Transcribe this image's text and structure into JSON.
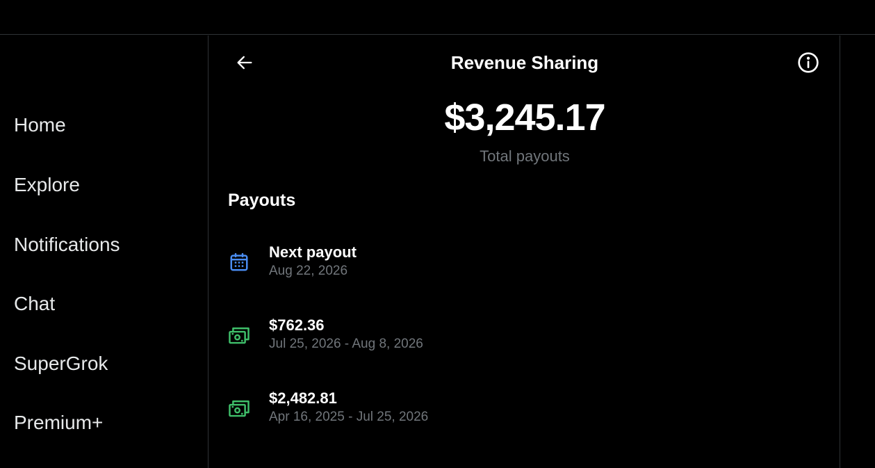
{
  "sidebar": {
    "items": [
      {
        "label": "Home"
      },
      {
        "label": "Explore"
      },
      {
        "label": "Notifications"
      },
      {
        "label": "Chat"
      },
      {
        "label": "SuperGrok"
      },
      {
        "label": "Premium+"
      }
    ]
  },
  "header": {
    "title": "Revenue Sharing",
    "back_icon": "arrow-left-icon",
    "info_icon": "info-icon"
  },
  "summary": {
    "total": "$3,245.17",
    "total_label": "Total payouts"
  },
  "payouts": {
    "section_title": "Payouts",
    "next": {
      "label": "Next payout",
      "date": "Aug 22, 2026",
      "icon": "calendar-icon"
    },
    "items": [
      {
        "amount": "$762.36",
        "period": "Jul 25, 2026 - Aug 8, 2026",
        "icon": "money-icon"
      },
      {
        "amount": "$2,482.81",
        "period": "Apr 16, 2025 - Jul 25, 2026",
        "icon": "money-icon"
      }
    ]
  },
  "colors": {
    "background": "#000000",
    "divider": "#2f3336",
    "text_primary": "#ffffff",
    "text_secondary": "#71767b",
    "calendar_icon": "#4a8cf0",
    "money_icon": "#3fbf6a"
  }
}
